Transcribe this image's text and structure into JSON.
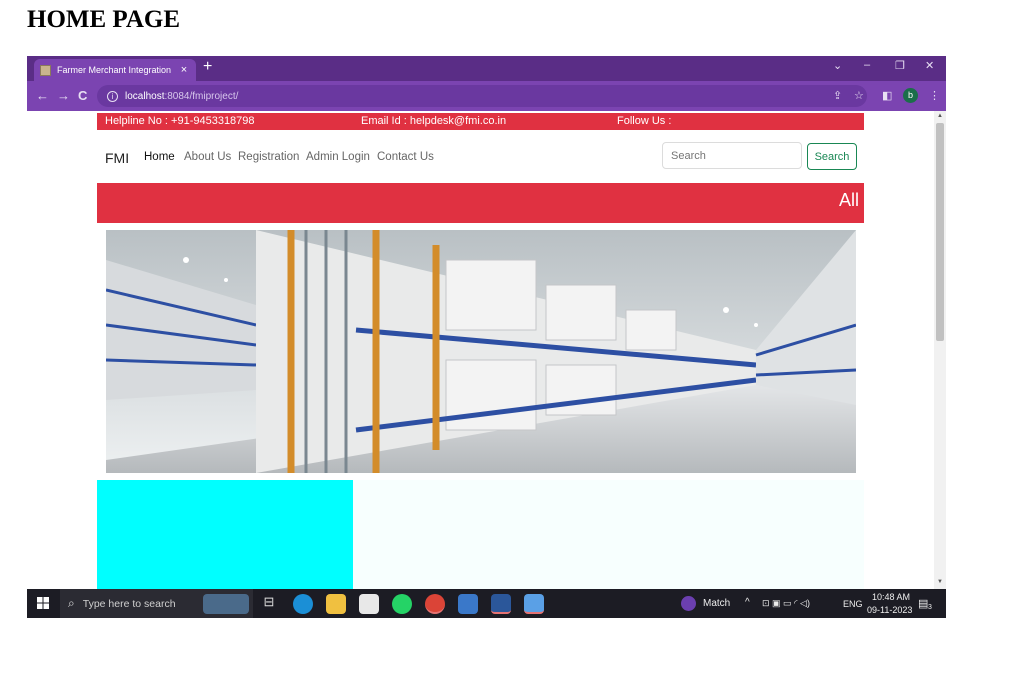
{
  "heading": "HOME PAGE",
  "browser": {
    "tab_title": "Farmer Merchant Integration",
    "tab_close": "×",
    "new_tab": "+",
    "url_host": "localhost",
    "url_path": ":8084/fmiproject/",
    "profile_initial": "b",
    "theme_color": "#7b44b1"
  },
  "site": {
    "topbar": {
      "helpline": "Helpline No : +91-9453318798",
      "email": "Email Id : helpdesk@fmi.co.in",
      "follow": "Follow Us :"
    },
    "brand": "FMI",
    "nav": [
      "Home",
      "About Us",
      "Registration",
      "Admin Login",
      "Contact Us"
    ],
    "search_placeholder": "Search",
    "search_button": "Search",
    "banner_label": "All",
    "accent_color": "#e03141"
  },
  "taskbar": {
    "search_text": "Type here to search",
    "match_label": "Match",
    "lang": "ENG",
    "time": "10:48 AM",
    "date": "09-11-2023",
    "notification_count": "3"
  }
}
